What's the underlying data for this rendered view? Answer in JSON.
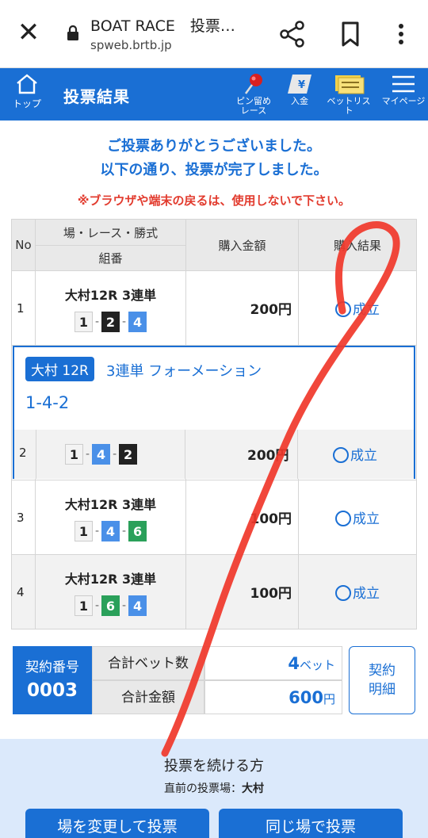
{
  "browser": {
    "title": "BOAT RACE　投票…",
    "url": "spweb.brtb.jp"
  },
  "header": {
    "top_label": "トップ",
    "title": "投票結果",
    "pin_label_1": "ピン留め",
    "pin_label_2": "レース",
    "deposit_label": "入金",
    "betlist_label": "ベットリスト",
    "mypage_label": "マイページ"
  },
  "messages": {
    "line1": "ご投票ありがとうございました。",
    "line2": "以下の通り、投票が完了しました。",
    "warning": "※ブラウザや端末の戻るは、使用しないで下さい。"
  },
  "table": {
    "headers": {
      "no": "No",
      "race": "場・レース・勝式",
      "combo": "組番",
      "amount": "購入金額",
      "result": "購入結果"
    },
    "rows": [
      {
        "no": "1",
        "race": "大村12R 3連単",
        "boats": [
          "1",
          "2",
          "4"
        ],
        "amount": "200円",
        "result": "成立"
      },
      {
        "no": "2",
        "race": "",
        "boats": [
          "1",
          "4",
          "2"
        ],
        "amount": "200円",
        "result": "成立"
      },
      {
        "no": "3",
        "race": "大村12R 3連単",
        "boats": [
          "1",
          "4",
          "6"
        ],
        "amount": "100円",
        "result": "成立"
      },
      {
        "no": "4",
        "race": "大村12R 3連単",
        "boats": [
          "1",
          "6",
          "4"
        ],
        "amount": "100円",
        "result": "成立"
      }
    ],
    "dash": "-"
  },
  "highlight": {
    "tag": "大村 12R",
    "type": "3連単 フォーメーション",
    "combo": "1-4-2"
  },
  "summary": {
    "contract_label": "契約番号",
    "contract_no": "0003",
    "total_bets_label": "合計ベット数",
    "total_bets_value": "4",
    "total_bets_unit": "ベット",
    "total_amount_label": "合計金額",
    "total_amount_value": "600",
    "total_amount_unit": "円",
    "detail_line1": "契約",
    "detail_line2": "明細"
  },
  "bottom": {
    "title": "投票を続ける方",
    "sub_label": "直前の投票場：",
    "sub_value": "大村",
    "btn_change": "場を変更して投票",
    "btn_same": "同じ場で投票"
  },
  "colors": {
    "brand_blue": "#1a6fd4",
    "warning_red": "#e23b2e",
    "scribble_red": "#f0372a"
  }
}
